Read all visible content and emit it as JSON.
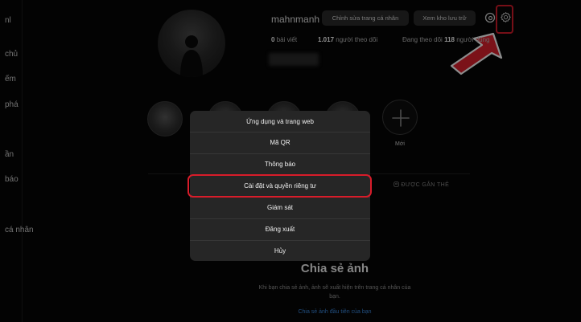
{
  "sidebar": {
    "items": [
      {
        "label": "nl"
      },
      {
        "label": "chủ"
      },
      {
        "label": "ếm"
      },
      {
        "label": "phá"
      },
      {
        "label": "ần"
      },
      {
        "label": "báo"
      },
      {
        "label": "cá nhân"
      }
    ]
  },
  "profile": {
    "username": "mahnmanh",
    "edit_profile_label": "Chỉnh sửa trang cá nhân",
    "view_archive_label": "Xem kho lưu trữ",
    "stats": {
      "posts_count": "0",
      "posts_label": "bài viết",
      "followers_count": "1.017",
      "followers_label": "người theo dõi",
      "following_label": "Đang theo dõi",
      "following_count": "118",
      "following_suffix": "người dùng"
    }
  },
  "highlights": {
    "new_label": "Mới"
  },
  "tabs": {
    "tagged_label": "ĐƯỢC GẮN THẺ"
  },
  "empty_state": {
    "title": "Chia sẻ ảnh",
    "description": "Khi bạn chia sẻ ảnh, ảnh sẽ xuất hiện trên trang cá nhân của bạn.",
    "cta": "Chia sẻ ảnh đầu tiên của bạn"
  },
  "menu": {
    "items": [
      {
        "label": "Ứng dụng và trang web"
      },
      {
        "label": "Mã QR"
      },
      {
        "label": "Thông báo"
      },
      {
        "label": "Cài đặt và quyền riêng tư"
      },
      {
        "label": "Giám sát"
      },
      {
        "label": "Đăng xuất"
      },
      {
        "label": "Hủy"
      }
    ]
  },
  "annotation": {
    "color": "#d81c2a"
  },
  "icons": [
    "threads-icon",
    "gear-icon",
    "plus-icon",
    "tag-icon",
    "arrow-pointer"
  ]
}
